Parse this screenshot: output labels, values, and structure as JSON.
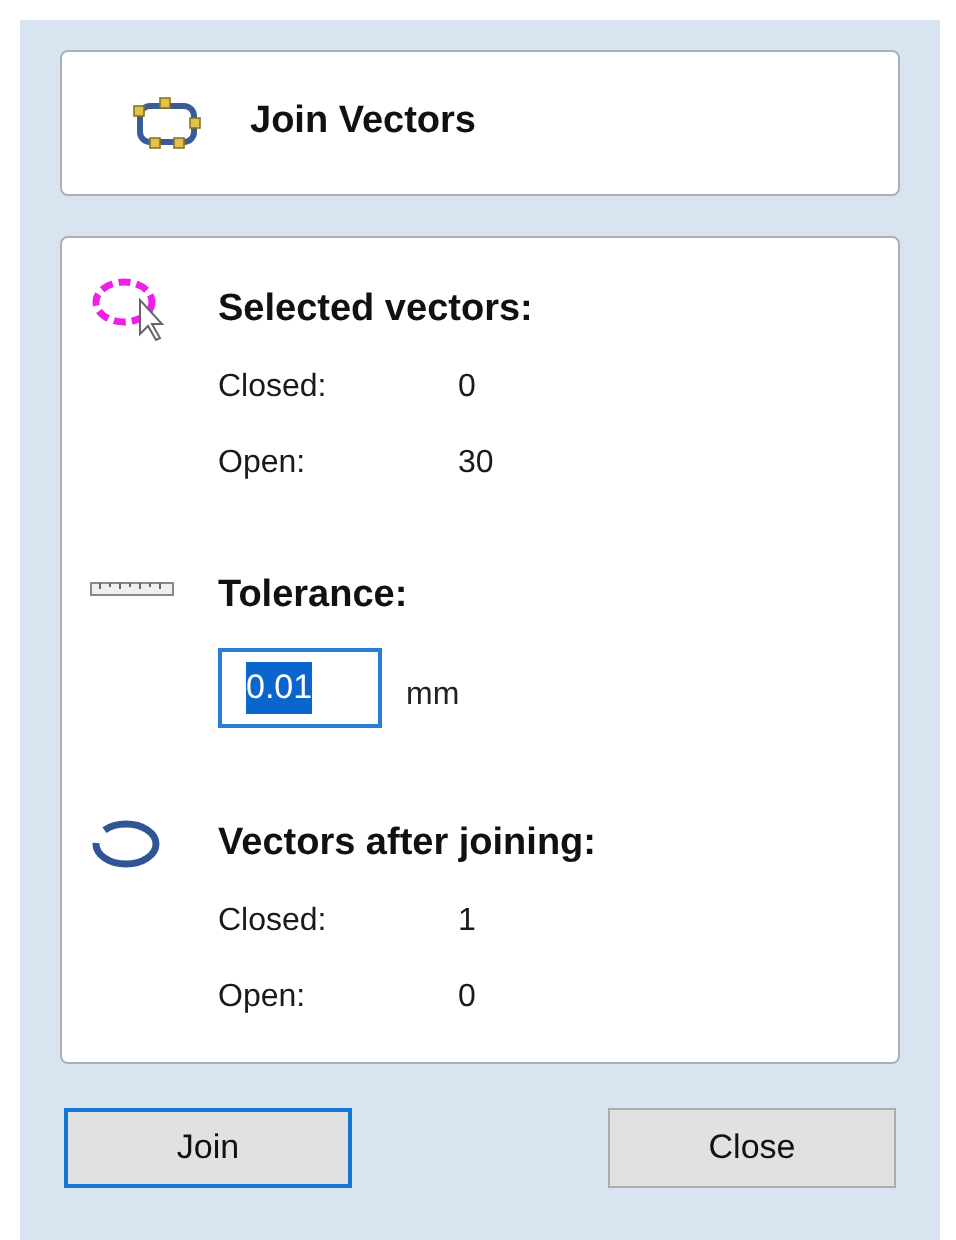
{
  "header": {
    "title": "Join Vectors"
  },
  "selected_vectors": {
    "heading": "Selected vectors:",
    "rows": [
      {
        "label": "Closed:",
        "value": "0"
      },
      {
        "label": "Open:",
        "value": "30"
      }
    ]
  },
  "tolerance": {
    "heading": "Tolerance:",
    "value": "0.01",
    "text_selected": true,
    "unit": "mm"
  },
  "after_joining": {
    "heading": "Vectors after joining:",
    "rows": [
      {
        "label": "Closed:",
        "value": "1"
      },
      {
        "label": "Open:",
        "value": "0"
      }
    ]
  },
  "buttons": [
    {
      "label": "Join",
      "focused": true
    },
    {
      "label": "Close",
      "focused": false
    }
  ]
}
